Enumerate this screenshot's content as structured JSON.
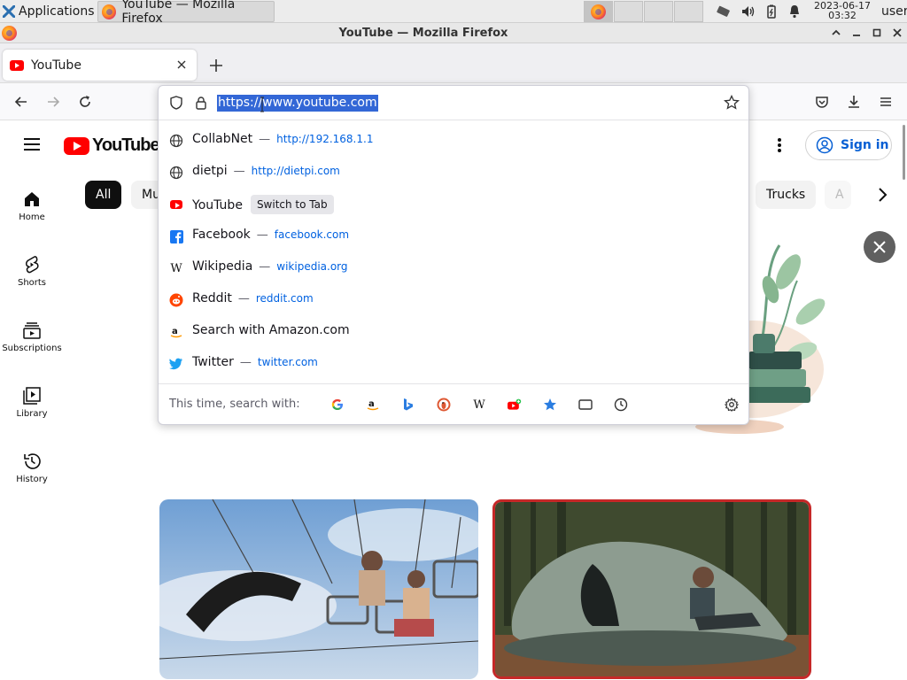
{
  "taskbar": {
    "applications_label": "Applications",
    "window_button_label": "YouTube — Mozilla Firefox",
    "clock_date": "2023-06-17",
    "clock_time": "03:32",
    "user_label": "user"
  },
  "window": {
    "title": "YouTube — Mozilla Firefox"
  },
  "browser": {
    "tab_title": "YouTube",
    "url": "https://www.youtube.com"
  },
  "url_dropdown": {
    "suggestions": [
      {
        "title": "CollabNet",
        "url": "http://192.168.1.1",
        "icon": "globe-icon"
      },
      {
        "title": "dietpi",
        "url": "http://dietpi.com",
        "icon": "globe-icon"
      },
      {
        "title": "YouTube",
        "action": "Switch to Tab",
        "icon": "youtube-icon"
      },
      {
        "title": "Facebook",
        "url": "facebook.com",
        "icon": "facebook-icon"
      },
      {
        "title": "Wikipedia",
        "url": "wikipedia.org",
        "icon": "wikipedia-icon"
      },
      {
        "title": "Reddit",
        "url": "reddit.com",
        "icon": "reddit-icon"
      },
      {
        "title": "Search with Amazon.com",
        "icon": "amazon-icon"
      },
      {
        "title": "Twitter",
        "url": "twitter.com",
        "icon": "twitter-icon"
      }
    ],
    "separator": "—",
    "footer_label": "This time, search with:",
    "engines": [
      "google-icon",
      "amazon-icon",
      "bing-icon",
      "duckduckgo-icon",
      "wikipedia-icon",
      "youtube-add-icon",
      "bookmarks-icon",
      "tabs-icon",
      "history-icon"
    ]
  },
  "youtube": {
    "logo_text": "YouTube",
    "sign_in_label": "Sign in",
    "guide": [
      {
        "label": "Home",
        "icon": "home-icon"
      },
      {
        "label": "Shorts",
        "icon": "shorts-icon"
      },
      {
        "label": "Subscriptions",
        "icon": "subscriptions-icon"
      },
      {
        "label": "Library",
        "icon": "library-icon"
      },
      {
        "label": "History",
        "icon": "history-icon"
      }
    ],
    "chips": {
      "all": "All",
      "mu": "Mu",
      "trucks": "Trucks",
      "partial": "A"
    }
  },
  "colors": {
    "youtube_red": "#ff0000",
    "selection_blue": "#3367d6",
    "link_blue": "#0061e0",
    "sign_in_blue": "#065fd4"
  }
}
